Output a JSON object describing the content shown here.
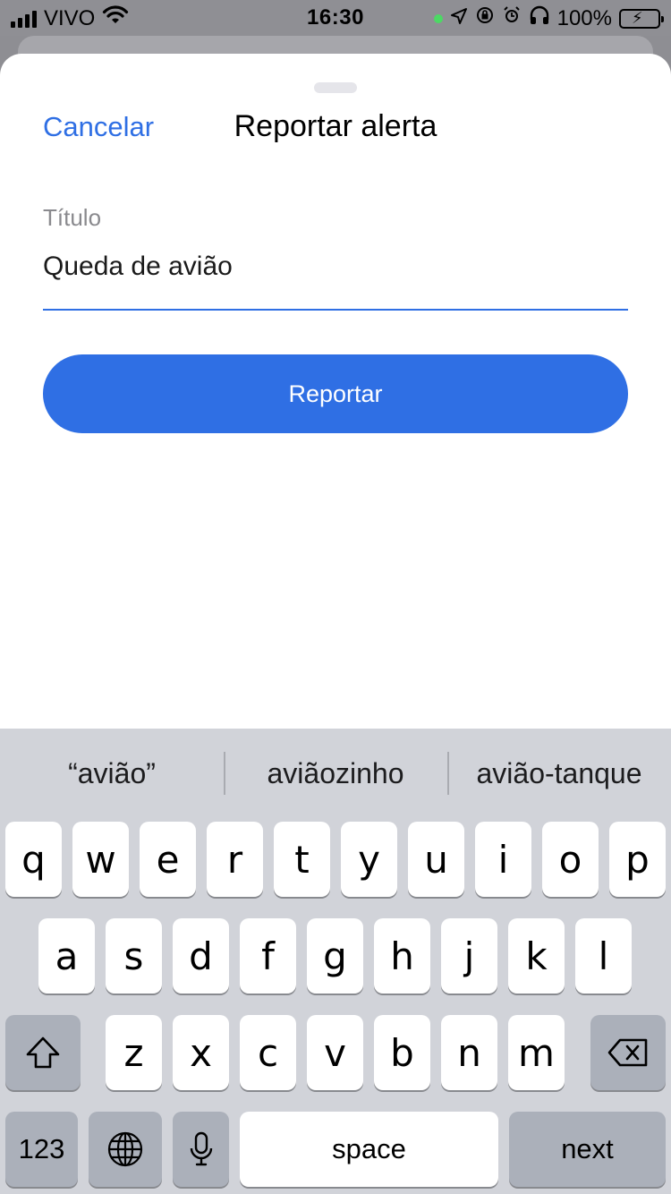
{
  "status_bar": {
    "carrier": "VIVO",
    "time": "16:30",
    "battery_percent": "100%",
    "icons": [
      "signal-icon",
      "wifi-icon",
      "location-icon",
      "rotation-lock-icon",
      "alarm-icon",
      "headphones-icon",
      "battery-charging-icon"
    ]
  },
  "sheet": {
    "cancel_label": "Cancelar",
    "title": "Reportar alerta",
    "field_label": "Título",
    "field_value": "Queda de avião",
    "submit_label": "Reportar",
    "accent_color": "#2f6fe4"
  },
  "keyboard": {
    "suggestions": [
      "“avião”",
      "aviãozinho",
      "avião-tanque"
    ],
    "row1": [
      "q",
      "w",
      "e",
      "r",
      "t",
      "y",
      "u",
      "i",
      "o",
      "p"
    ],
    "row2": [
      "a",
      "s",
      "d",
      "f",
      "g",
      "h",
      "j",
      "k",
      "l"
    ],
    "row3": [
      "z",
      "x",
      "c",
      "v",
      "b",
      "n",
      "m"
    ],
    "numbers_label": "123",
    "space_label": "space",
    "next_label": "next"
  }
}
